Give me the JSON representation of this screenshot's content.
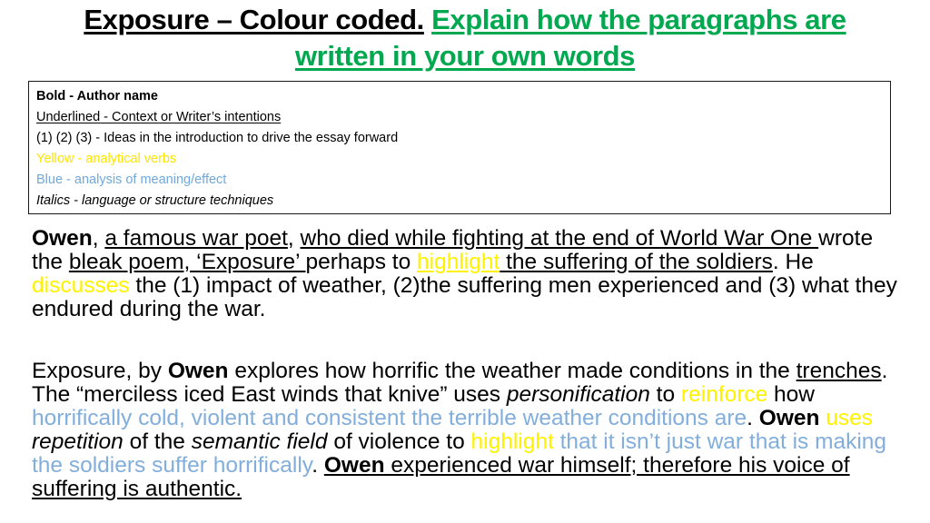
{
  "slide": {
    "title": {
      "black_part": "Exposure – Colour coded.",
      "green_part": "Explain how the paragraphs are written in your own words",
      "green_color": "#00A950",
      "black_color": "#000000"
    },
    "key_box": {
      "border_color": "#1a1a1a",
      "lines": [
        {
          "marker": "Bold",
          "separator": " - ",
          "description": "Author name",
          "style": "bold"
        },
        {
          "marker": "Underlined",
          "separator": " - ",
          "description": "Context or Writer’s intentions",
          "style": "underline"
        },
        {
          "marker": "(1) (2) (3)",
          "separator": " - ",
          "description": "Ideas in the introduction to drive the essay forward",
          "style": "plain"
        },
        {
          "marker": "Yellow",
          "separator": " - ",
          "description": "analytical verbs",
          "style": "yellow",
          "color": "#FFE400"
        },
        {
          "marker": "Blue",
          "separator": " - ",
          "description": "analysis of meaning/effect",
          "style": "blue",
          "color": "#6FA8DC"
        },
        {
          "marker": "Italics",
          "separator": " - ",
          "description": "language or structure techniques",
          "style": "italic"
        }
      ]
    },
    "paragraphs": [
      {
        "id": "paragraph-one",
        "plain_text": "Owen, a famous war poet, who died while fighting at the end of World War One wrote the bleak poem, ‘Exposure’ perhaps to highlight the suffering of the soldiers. He discusses the (1) impact of  weather, (2)the suffering men experienced and (3) what they endured during the war.",
        "runs": [
          {
            "t": "Owen",
            "bold": true
          },
          {
            "t": ", "
          },
          {
            "t": "a famous war poet",
            "underline": true
          },
          {
            "t": ", "
          },
          {
            "t": "who died while fighting at the end of World War One ",
            "underline": true
          },
          {
            "t": "wrote the "
          },
          {
            "t": "bleak poem, ‘Exposure’ ",
            "underline": true
          },
          {
            "t": "perhaps to "
          },
          {
            "t": "highlight",
            "underline": true,
            "color": "yellow"
          },
          {
            "t": " ",
            "underline": true
          },
          {
            "t": "the suffering of the soldiers",
            "underline": true
          },
          {
            "t": ". He "
          },
          {
            "t": "discusses",
            "color": "yellow"
          },
          {
            "t": " the (1) impact of  weather, (2)the suffering men experienced and (3) what they endured during the war."
          }
        ]
      },
      {
        "id": "paragraph-two",
        "plain_text": "Exposure, by Owen explores how horrific the weather made conditions in the trenches. The “merciless iced East winds that knive” uses personification to reinforce how horrifically cold, violent and consistent the terrible weather conditions are. Owen uses repetition of the semantic field of violence to highlight that it isn’t just war that is making the soldiers suffer horrifically. Owen experienced war himself; therefore his voice of suffering is authentic.",
        "runs": [
          {
            "t": "Exposure, by "
          },
          {
            "t": "Owen",
            "bold": true
          },
          {
            "t": " explores how horrific the weather made conditions in the "
          },
          {
            "t": "trenches",
            "underline": true
          },
          {
            "t": ". The “merciless iced East winds that knive” uses "
          },
          {
            "t": "personification",
            "italic": true
          },
          {
            "t": " to "
          },
          {
            "t": "reinforce",
            "color": "yellow"
          },
          {
            "t": " how "
          },
          {
            "t": "horrifically cold, violent and consistent the terrible weather conditions are",
            "color": "blue"
          },
          {
            "t": ". "
          },
          {
            "t": "Owen",
            "bold": true
          },
          {
            "t": " "
          },
          {
            "t": "uses",
            "color": "yellow"
          },
          {
            "t": " "
          },
          {
            "t": "repetition",
            "italic": true
          },
          {
            "t": " of the "
          },
          {
            "t": "semantic field",
            "italic": true
          },
          {
            "t": " of violence to "
          },
          {
            "t": "highlight",
            "color": "yellow"
          },
          {
            "t": " "
          },
          {
            "t": "that it isn’t just war that is making the soldiers suffer horrifically",
            "color": "blue"
          },
          {
            "t": ". "
          },
          {
            "t": "Owen",
            "bold": true,
            "underline": true
          },
          {
            "t": " experienced war himself; therefore his voice of suffering is authentic.",
            "underline": true
          }
        ]
      }
    ],
    "colors": {
      "yellow": "#FFF200",
      "blue": "#82AEDC",
      "green": "#00A950",
      "black": "#000000"
    }
  }
}
